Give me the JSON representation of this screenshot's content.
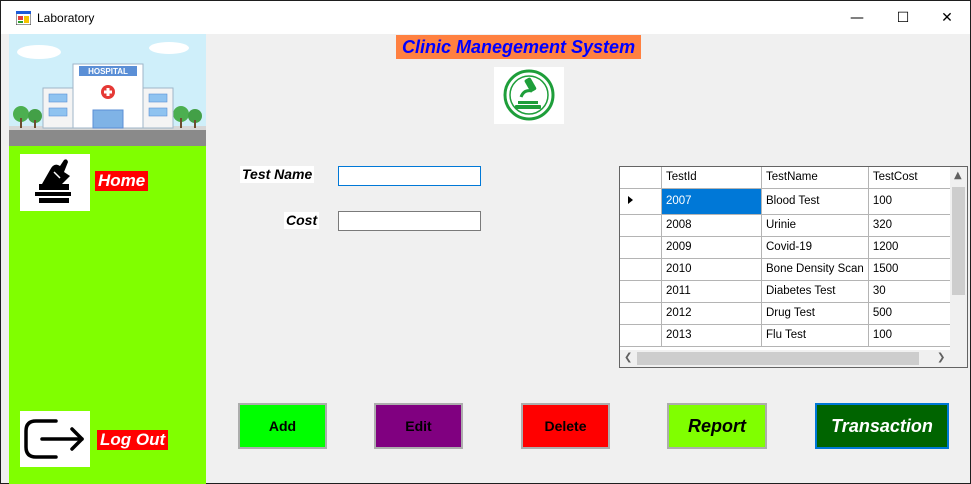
{
  "window": {
    "title": "Laboratory",
    "controls": {
      "minimize": "—",
      "maximize": "☐",
      "close": "✕"
    }
  },
  "header": {
    "title": "Clinic Manegement System",
    "logo_icon": "microscope-icon"
  },
  "sidebar": {
    "banner_icon": "hospital-illustration",
    "banner_text": "HOSPITAL",
    "home": {
      "label": "Home",
      "icon": "home-hand-icon"
    },
    "logout": {
      "label": "Log Out",
      "icon": "logout-door-icon"
    }
  },
  "form": {
    "test_name": {
      "label": "Test Name",
      "value": ""
    },
    "cost": {
      "label": "Cost",
      "value": ""
    }
  },
  "grid": {
    "columns": [
      "TestId",
      "TestName",
      "TestCost"
    ],
    "rows": [
      [
        "2007",
        "Blood Test",
        "100"
      ],
      [
        "2008",
        "Urinie",
        "320"
      ],
      [
        "2009",
        "Covid-19",
        "1200"
      ],
      [
        "2010",
        "Bone Density Scan",
        "1500"
      ],
      [
        "2011",
        "Diabetes Test",
        "30"
      ],
      [
        "2012",
        "Drug Test",
        "500"
      ],
      [
        "2013",
        "Flu Test",
        "100"
      ]
    ],
    "selected_row": 0
  },
  "buttons": {
    "add": "Add",
    "edit": "Edit",
    "delete": "Delete",
    "report": "Report",
    "transaction": "Transaction"
  },
  "colors": {
    "sidebar": "#80ff00",
    "title_bg": "#ff8040",
    "title_fg": "#0000ff",
    "add": "#00ff00",
    "edit": "#800080",
    "delete": "#ff0000",
    "report": "#80ff00",
    "transaction": "#006400"
  }
}
